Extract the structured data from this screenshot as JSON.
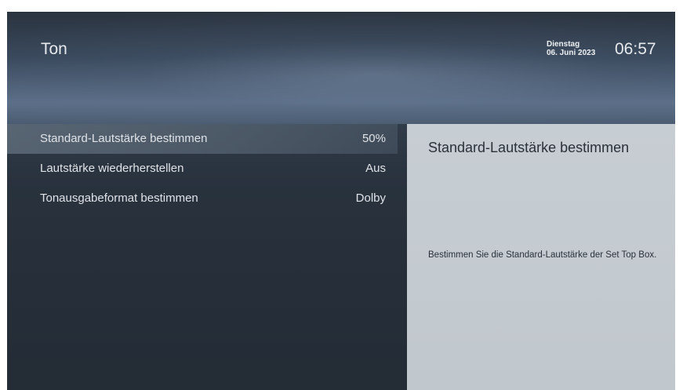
{
  "header": {
    "title": "Ton",
    "weekday": "Dienstag",
    "date": "06. Juni 2023",
    "time": "06:57"
  },
  "menu": {
    "items": [
      {
        "label": "Standard-Lautstärke bestimmen",
        "value": "50%",
        "selected": true
      },
      {
        "label": "Lautstärke wiederherstellen",
        "value": "Aus",
        "selected": false
      },
      {
        "label": "Tonausgabeformat bestimmen",
        "value": "Dolby",
        "selected": false
      }
    ]
  },
  "info_panel": {
    "title": "Standard-Lautstärke bestimmen",
    "description": "Bestimmen Sie die Standard-Lautstärke der Set Top Box."
  },
  "colors": {
    "panel_background": "#c4cbd1",
    "text_light": "#e6e9ed",
    "text_dark": "#2a3139"
  }
}
